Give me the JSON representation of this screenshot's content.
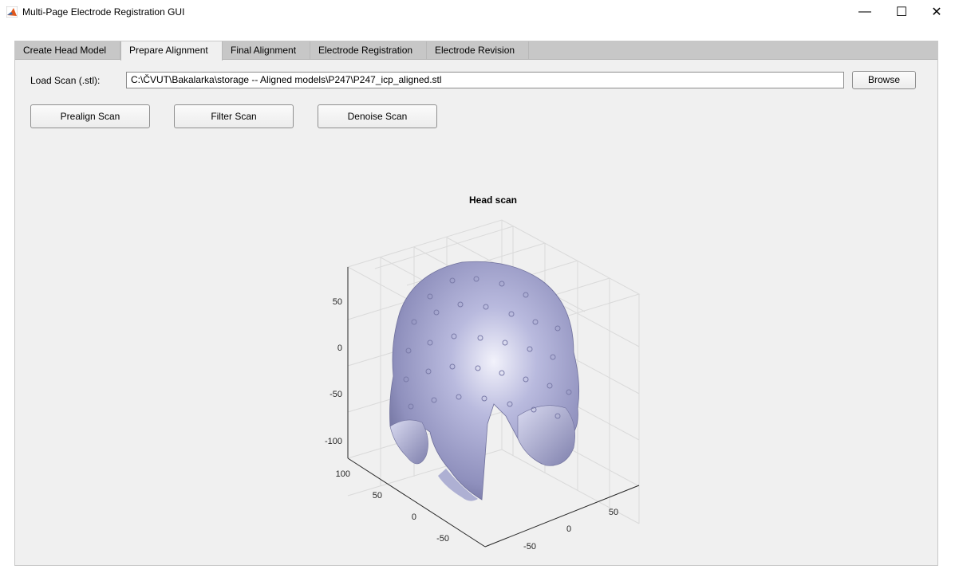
{
  "window": {
    "title": "Multi-Page Electrode Registration GUI",
    "minimize_glyph": "—",
    "maximize_glyph": "☐",
    "close_glyph": "✕"
  },
  "tabs": [
    {
      "label": "Create Head Model",
      "active": false
    },
    {
      "label": "Prepare Alignment",
      "active": true
    },
    {
      "label": "Final Alignment",
      "active": false
    },
    {
      "label": "Electrode Registration",
      "active": false
    },
    {
      "label": "Electrode Revision",
      "active": false
    }
  ],
  "load_scan": {
    "label": "Load Scan (.stl):",
    "path": "C:\\ČVUT\\Bakalarka\\storage -- Aligned models\\P247\\P247_icp_aligned.stl",
    "browse_label": "Browse"
  },
  "actions": {
    "prealign_label": "Prealign Scan",
    "filter_label": "Filter Scan",
    "denoise_label": "Denoise Scan"
  },
  "plot": {
    "title": "Head scan",
    "z_ticks": [
      "50",
      "0",
      "-50",
      "-100"
    ],
    "left_ticks": [
      "100",
      "50",
      "0",
      "-50"
    ],
    "right_ticks": [
      "-50",
      "0",
      "50"
    ],
    "surface_color": "#a7a8cf"
  },
  "colors": {
    "panel_bg": "#f0f0f0",
    "tab_strip": "#c7c7c7",
    "matlab_icon": "#e1571b"
  }
}
